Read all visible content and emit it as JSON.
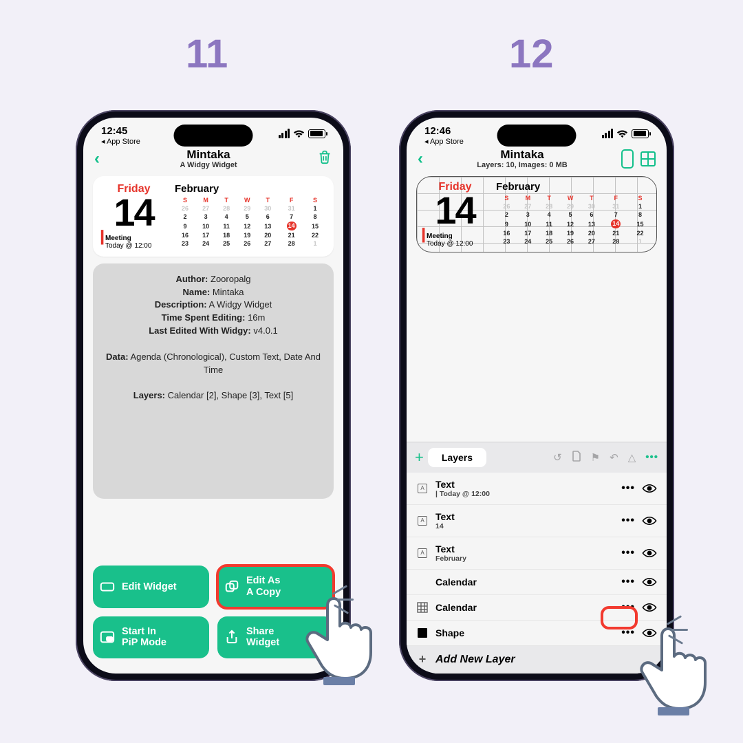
{
  "steps": {
    "left": "11",
    "right": "12"
  },
  "status": {
    "time1": "12:45",
    "time2": "12:46",
    "back": "◂ App Store"
  },
  "nav": {
    "title": "Mintaka",
    "sub1": "A Widgy Widget",
    "sub2": "Layers: 10, Images: 0 MB"
  },
  "widget": {
    "day": "Friday",
    "date": "14",
    "month": "February",
    "event_title": "Meeting",
    "event_sub": "Today @ 12:00",
    "weekdays": [
      "S",
      "M",
      "T",
      "W",
      "T",
      "F",
      "S"
    ],
    "weeks": [
      [
        {
          "d": "26",
          "m": 1
        },
        {
          "d": "27",
          "m": 1
        },
        {
          "d": "28",
          "m": 1
        },
        {
          "d": "29",
          "m": 1
        },
        {
          "d": "30",
          "m": 1
        },
        {
          "d": "31",
          "m": 1
        },
        {
          "d": "1"
        }
      ],
      [
        {
          "d": "2"
        },
        {
          "d": "3"
        },
        {
          "d": "4"
        },
        {
          "d": "5"
        },
        {
          "d": "6"
        },
        {
          "d": "7"
        },
        {
          "d": "8"
        }
      ],
      [
        {
          "d": "9"
        },
        {
          "d": "10"
        },
        {
          "d": "11"
        },
        {
          "d": "12"
        },
        {
          "d": "13"
        },
        {
          "d": "14",
          "t": 1
        },
        {
          "d": "15"
        }
      ],
      [
        {
          "d": "16"
        },
        {
          "d": "17"
        },
        {
          "d": "18"
        },
        {
          "d": "19"
        },
        {
          "d": "20"
        },
        {
          "d": "21"
        },
        {
          "d": "22"
        }
      ],
      [
        {
          "d": "23"
        },
        {
          "d": "24"
        },
        {
          "d": "25"
        },
        {
          "d": "26"
        },
        {
          "d": "27"
        },
        {
          "d": "28"
        },
        {
          "d": "1",
          "m": 1
        }
      ]
    ]
  },
  "info": {
    "author_l": "Author:",
    "author_v": " Zooropalg",
    "name_l": "Name:",
    "name_v": " Mintaka",
    "desc_l": "Description:",
    "desc_v": " A Widgy Widget",
    "time_l": "Time Spent Editing:",
    "time_v": " 16m",
    "last_l": "Last Edited With Widgy:",
    "last_v": " v4.0.1",
    "data_l": "Data:",
    "data_v": " Agenda (Chronological), Custom Text, Date And Time",
    "layers_l": "Layers:",
    "layers_v": " Calendar [2], Shape [3], Text [5]"
  },
  "actions": {
    "edit": "Edit Widget",
    "copy": "Edit As\nA Copy",
    "pip": "Start In\nPiP Mode",
    "share": "Share\nWidget"
  },
  "panel": {
    "tab": "Layers",
    "addnew": "Add New Layer",
    "plus": "+",
    "more": "•••",
    "items": [
      {
        "name": "Text",
        "sub": "| Today @ 12:00",
        "icon": "a"
      },
      {
        "name": "Text",
        "sub": "14",
        "icon": "a"
      },
      {
        "name": "Text",
        "sub": "February",
        "icon": "a"
      },
      {
        "name": "Calendar",
        "sub": "",
        "icon": ""
      },
      {
        "name": "Calendar",
        "sub": "",
        "icon": "grid"
      },
      {
        "name": "Shape",
        "sub": "",
        "icon": "fill"
      }
    ]
  }
}
